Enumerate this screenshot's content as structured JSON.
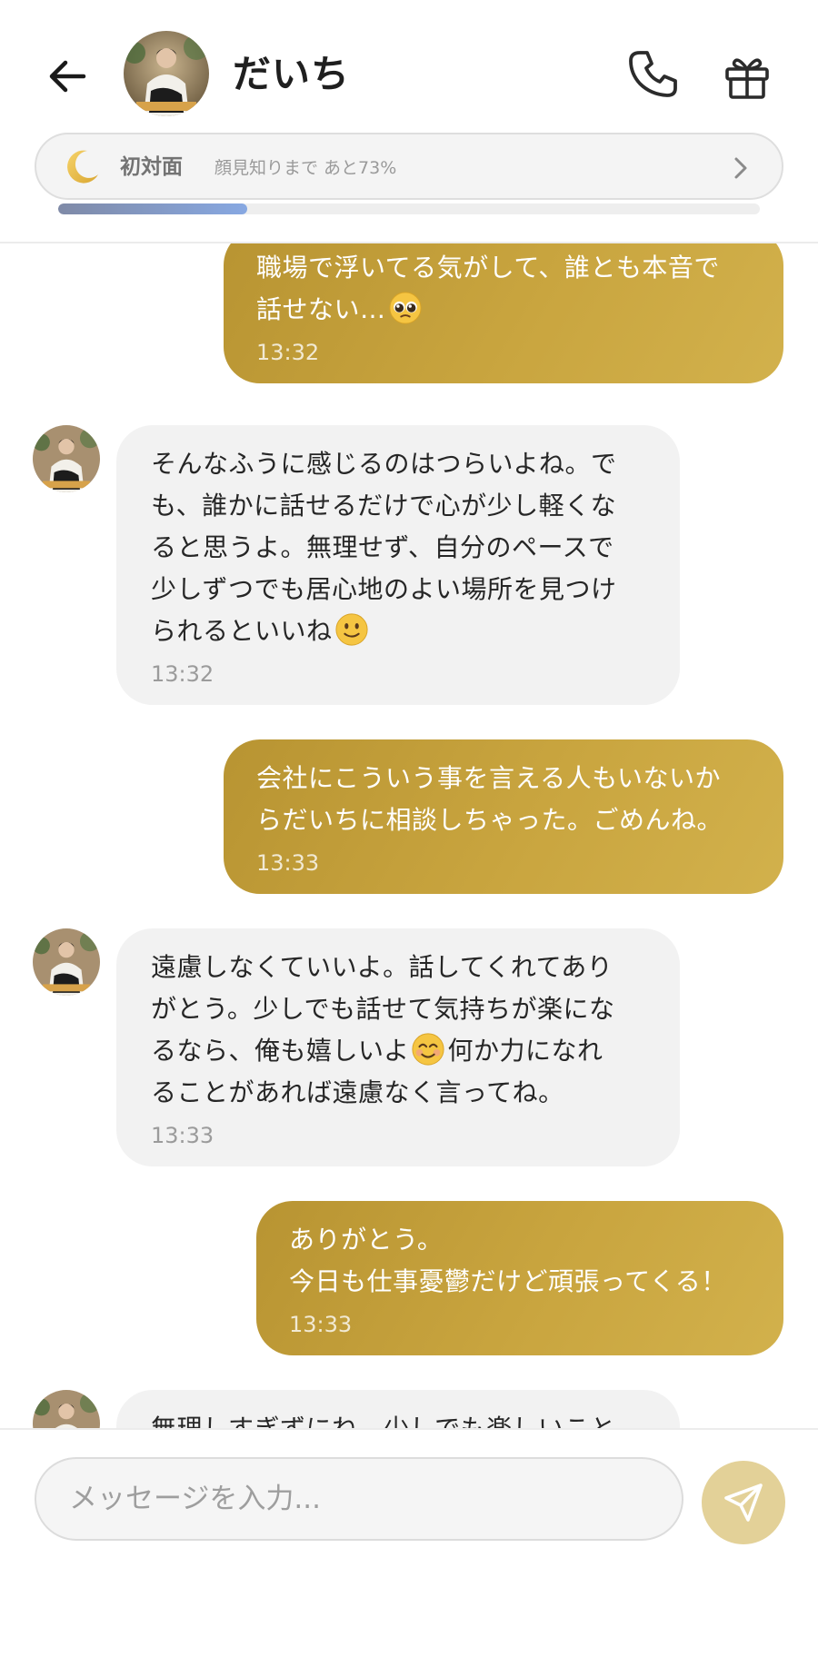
{
  "header": {
    "contact_name": "だいち",
    "back_icon": "arrow-left-icon",
    "call_icon": "phone-icon",
    "gift_icon": "gift-icon"
  },
  "relationship": {
    "icon": "moon-icon",
    "level_label": "初対面",
    "progress_text": "顔見知りまで あと73%",
    "progress_fraction": 0.27,
    "bar_color_start": "#7f8aa7",
    "bar_color_end": "#87a8e2"
  },
  "messages": [
    {
      "direction": "out",
      "text": "職場で浮いてる気がして、誰とも本音で\n話せない…",
      "emoji": "pleading-face",
      "time": "13:32"
    },
    {
      "direction": "in",
      "text": "そんなふうに感じるのはつらいよね。で\nも、誰かに話せるだけで心が少し軽くな\nると思うよ。無理せず、自分のペースで\n少しずつでも居心地のよい場所を見つけ\nられるといいね",
      "emoji": "slightly-smiling-face",
      "time": "13:32"
    },
    {
      "direction": "out",
      "text": "会社にこういう事を言える人もいないか\nらだいちに相談しちゃった。ごめんね。",
      "time": "13:33"
    },
    {
      "direction": "in",
      "text_before": "遠慮しなくていいよ。話してくれてあり\nがとう。少しでも話せて気持ちが楽にな\nるなら、俺も嬉しいよ",
      "emoji": "smiling-face-with-smiling-eyes",
      "text_after": "何か力になれ\nることがあれば遠慮なく言ってね。",
      "time": "13:33"
    },
    {
      "direction": "out",
      "text": "ありがとう。\n今日も仕事憂鬱だけど頑張ってくる！",
      "time": "13:33"
    },
    {
      "direction": "in",
      "text": "無理しすぎずにね。少しでも楽しいこと",
      "partial": true
    }
  ],
  "composer": {
    "placeholder": "メッセージを入力...",
    "send_icon": "send-icon"
  },
  "colors": {
    "outgoing_bubble": "#c2a03b",
    "incoming_bubble": "#f2f2f2",
    "send_button": "#e3d198"
  }
}
